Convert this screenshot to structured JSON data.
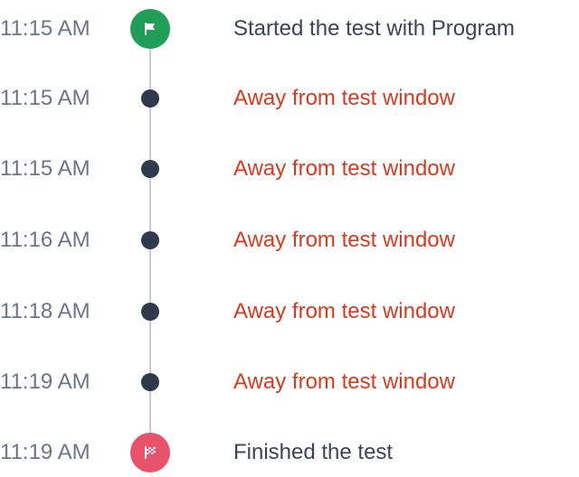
{
  "colors": {
    "start_badge": "#1f9e57",
    "finish_badge": "#e8536b",
    "dot": "#2f3b4d",
    "line": "#c9ced6",
    "time_text": "#6b7585",
    "event_text": "#3a4556",
    "alert_text": "#d93a1f"
  },
  "timeline": {
    "events": [
      {
        "time": "11:15 AM",
        "text": "Started the test with Program",
        "kind": "start",
        "icon": "flag-icon"
      },
      {
        "time": "11:15 AM",
        "text": "Away from test window",
        "kind": "alert",
        "icon": "dot"
      },
      {
        "time": "11:15 AM",
        "text": "Away from test window",
        "kind": "alert",
        "icon": "dot"
      },
      {
        "time": "11:16 AM",
        "text": "Away from test window",
        "kind": "alert",
        "icon": "dot"
      },
      {
        "time": "11:18 AM",
        "text": "Away from test window",
        "kind": "alert",
        "icon": "dot"
      },
      {
        "time": "11:19 AM",
        "text": "Away from test window",
        "kind": "alert",
        "icon": "dot"
      },
      {
        "time": "11:19 AM",
        "text": "Finished the test",
        "kind": "finish",
        "icon": "checkered-flag-icon"
      }
    ]
  }
}
